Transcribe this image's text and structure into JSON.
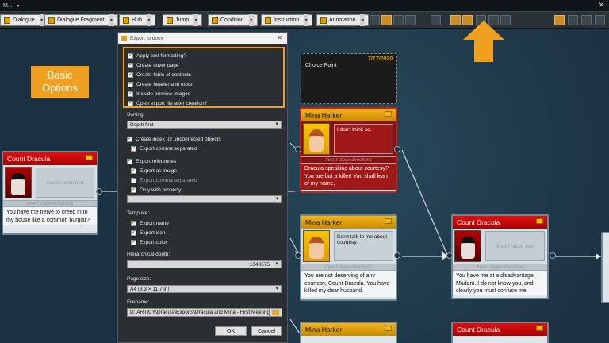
{
  "window": {
    "title": "M...",
    "title_suffix": "▸",
    "close": "✕"
  },
  "toolbar": {
    "buttons": [
      "Dialogue",
      "Dialogue Fragment",
      "Hub",
      "Jump",
      "Condition",
      "Instruction",
      "Annotation"
    ],
    "dropdown_glyph": "▾",
    "icon_names": [
      "search-icon",
      "grid-icon",
      "list-icon",
      "layout-icon",
      "export-word-icon",
      "export-excel-icon",
      "export-image-icon",
      "view-toggle-icon",
      "view-columns-icon",
      "view-table-icon"
    ],
    "accent": "#f0a020"
  },
  "callout": {
    "text_line1": "Basic",
    "text_line2": "Options"
  },
  "dialog": {
    "title": "Export to docx",
    "close": "✕",
    "basic_options": [
      {
        "label": "Apply text formatting?",
        "checked": true
      },
      {
        "label": "Create cover page",
        "checked": true
      },
      {
        "label": "Create table of contents",
        "checked": true
      },
      {
        "label": "Create header and footer",
        "checked": true
      },
      {
        "label": "Include preview images",
        "checked": true
      },
      {
        "label": "Open export file after creation?",
        "checked": true
      }
    ],
    "sorting_label": "Sorting:",
    "sorting_value": "Depth first",
    "index_label": "Create index for unconnected objects",
    "index_sub": "Export comma separated",
    "refs_label": "Export references",
    "refs_opts": [
      "Export as image",
      "Export comma separated",
      "Only with property:"
    ],
    "refs_checked": [
      true,
      false,
      true
    ],
    "property_value": "",
    "template_label": "Template:",
    "template_opts": [
      "Export name",
      "Export icon",
      "Export color"
    ],
    "depth_label": "Hierarchical depth:",
    "depth_value": "1048575",
    "page_label": "Page size:",
    "page_value": "A4 (8.3 × 11.7 in)",
    "file_label": "Filename:",
    "file_value": "D:\\ARTICY\\Dracula\\Exports\\Dracula and Mina - First Meeting",
    "ok": "OK",
    "cancel": "Cancel"
  },
  "choice_point": {
    "date": "7/17/2020",
    "label": "Choice Point"
  },
  "nodes": {
    "dracula_left": {
      "name": "Count Dracula",
      "menu": "Insert menu text",
      "stage": "Insert stage directions",
      "text": "You have the nerve to creep in to my house like a common burglar?"
    },
    "mina1": {
      "name": "Mina Harker",
      "menu": "I don't think so.",
      "stage": "Insert stage directions",
      "text": "Dracula speaking about courtesy? You are but a killer! You shall learn of my name,"
    },
    "mina2": {
      "name": "Mina Harker",
      "menu": "Don't talk to me about courtesy.",
      "stage": "Insert stage directions",
      "text": "You are not deserving of any courtesy, Count Dracula. You have killed my dear husband,"
    },
    "dracula_right": {
      "name": "Count Dracula",
      "menu": "Insert menu text",
      "stage": "Insert stage directions",
      "text": "You have me at a disadvantage, Madam. I do not know you, and clearly you must confuse me"
    },
    "mina3": {
      "name": "Mina Harker"
    },
    "dracula3": {
      "name": "Count Dracula"
    }
  }
}
